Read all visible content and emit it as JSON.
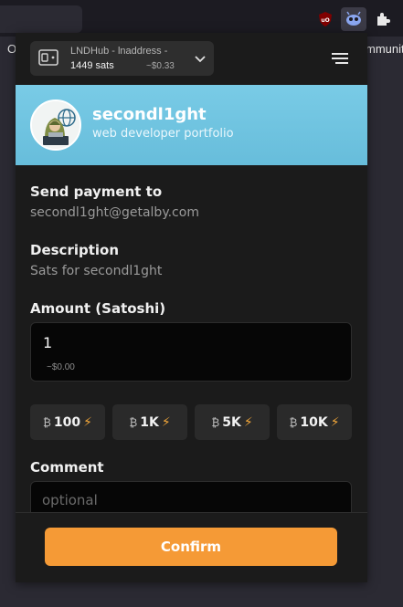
{
  "browser": {
    "left_text": "O",
    "right_text": "mmunit",
    "extensions": [
      "ublock-origin-icon",
      "alby-icon",
      "puzzle-icon"
    ]
  },
  "account": {
    "name": "LNDHub - lnaddress -",
    "balance": "1449 sats",
    "fiat": "~$0.33"
  },
  "recipient": {
    "name": "secondl1ght",
    "description": "web developer portfolio"
  },
  "form": {
    "send_to_label": "Send payment to",
    "send_to_value": "secondl1ght@getalby.com",
    "description_label": "Description",
    "description_value": "Sats for secondl1ght",
    "amount_label": "Amount (Satoshi)",
    "amount_value": "1",
    "amount_fiat": "~$0.00",
    "presets": [
      {
        "label": "100",
        "icon": "bolt"
      },
      {
        "label": "1K",
        "icon": "bolt"
      },
      {
        "label": "5K",
        "icon": "bolt"
      },
      {
        "label": "10K",
        "icon": "bolt"
      }
    ],
    "comment_label": "Comment",
    "comment_placeholder": "optional",
    "confirm_label": "Confirm"
  },
  "colors": {
    "accent": "#f59a36",
    "hero": "#79cbe6",
    "popup_bg": "#1b1b1b"
  }
}
